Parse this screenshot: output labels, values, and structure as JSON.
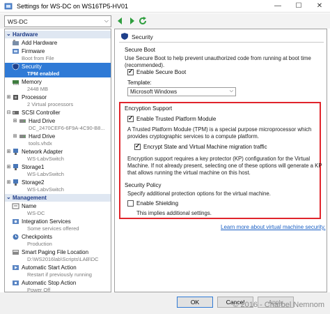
{
  "window": {
    "title": "Settings for WS-DC on WS16TP5-HV01"
  },
  "toolbar": {
    "vm_name": "WS-DC"
  },
  "hardware_header": "Hardware",
  "management_header": "Management",
  "hardware": {
    "add_hardware": {
      "label": "Add Hardware"
    },
    "firmware": {
      "label": "Firmware",
      "detail": "Boot from File"
    },
    "security": {
      "label": "Security",
      "detail": "TPM enabled"
    },
    "memory": {
      "label": "Memory",
      "detail": "2448 MB"
    },
    "processor": {
      "label": "Processor",
      "detail": "2 Virtual processors"
    },
    "scsi": {
      "label": "SCSI Controller"
    },
    "hard_drive_1": {
      "label": "Hard Drive",
      "detail": "DC_2470CEF6-6F9A-4C90-B8..."
    },
    "hard_drive_2": {
      "label": "Hard Drive",
      "detail": "tools.vhdx"
    },
    "network_adapter": {
      "label": "Network Adapter",
      "detail": "WS-LabvSwitch"
    },
    "storage1": {
      "label": "Storage1",
      "detail": "WS-LabvSwitch"
    },
    "storage2": {
      "label": "Storage2",
      "detail": "WS-LabvSwitch"
    }
  },
  "management": {
    "name": {
      "label": "Name",
      "detail": "WS-DC"
    },
    "integration": {
      "label": "Integration Services",
      "detail": "Some services offered"
    },
    "checkpoints": {
      "label": "Checkpoints",
      "detail": "Production"
    },
    "paging": {
      "label": "Smart Paging File Location",
      "detail": "D:\\WS2016lab\\Scripts\\LAB\\DC"
    },
    "autostart": {
      "label": "Automatic Start Action",
      "detail": "Restart if previously running"
    },
    "autostop": {
      "label": "Automatic Stop Action",
      "detail": "Power Off"
    }
  },
  "security_pane": {
    "title": "Security",
    "secure_boot_heading": "Secure Boot",
    "secure_boot_text": "Use Secure Boot to help prevent unauthorized code from running at boot time (recommended).",
    "enable_secure_boot": "Enable Secure Boot",
    "enable_secure_boot_checked": true,
    "template_label": "Template:",
    "template_value": "Microsoft Windows",
    "encryption_heading": "Encryption Support",
    "enable_tpm": "Enable Trusted Platform Module",
    "enable_tpm_checked": true,
    "tpm_text_1": "A Trusted Platform Module (TPM) is a special purpose microprocessor which",
    "tpm_text_2": "provides cryptographic services to a compute platform.",
    "encrypt_state": "Encrypt State and Virtual Machine migration traffic",
    "encrypt_state_checked": true,
    "kp_text_1": "Encryption support requires a key protector (KP) configuration for the Virtual",
    "kp_text_2": "Machine. If not already present, selecting one of these options will generate a KP",
    "kp_text_3": "that allows running the virtual machine on this host.",
    "policy_heading": "Security Policy",
    "policy_text": "Specify additional protection options for the virtual machine.",
    "enable_shielding": "Enable Shielding",
    "enable_shielding_checked": false,
    "shielding_note": "This implies additional settings.",
    "learn_more": "Learn more about virtual machine security."
  },
  "footer": {
    "ok_label": "OK",
    "cancel_label": "Cancel",
    "apply_label": "Apply",
    "watermark": "© 2016 - Charbel Nemnom"
  },
  "colors": {
    "selected": "#2f7ad6",
    "highlight_box": "#e0242b",
    "link": "#1a5fc4",
    "section_header_bg": "#dfe7f2"
  }
}
